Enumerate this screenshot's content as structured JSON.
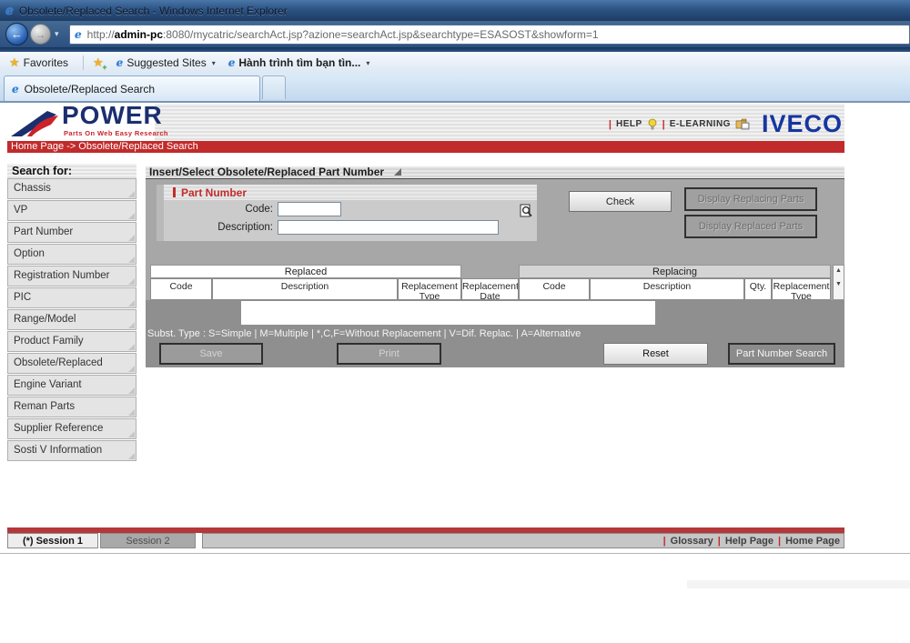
{
  "window": {
    "title": "Obsolete/Replaced Search - Windows Internet Explorer"
  },
  "address_bar": {
    "protocol": "http://",
    "host": "admin-pc",
    "path": ":8080/mycatric/searchAct.jsp?azione=searchAct.jsp&searchtype=ESASOST&showform=1"
  },
  "favorites_bar": {
    "favorites": "Favorites",
    "suggested_sites": "Suggested Sites",
    "pinned_link": "Hành trình tìm bạn tìn..."
  },
  "tabs": {
    "active": "Obsolete/Replaced Search"
  },
  "masthead": {
    "logo": "POWER",
    "tagline": "Parts On Web Easy Research",
    "help": "HELP",
    "elearning": "E-LEARNING",
    "brand": "IVECO"
  },
  "breadcrumb": "Home Page -> Obsolete/Replaced Search",
  "sidebar": {
    "title": "Search for:",
    "items": [
      {
        "label": "Chassis"
      },
      {
        "label": "VP"
      },
      {
        "label": "Part Number"
      },
      {
        "label": "Option"
      },
      {
        "label": "Registration Number"
      },
      {
        "label": "PIC"
      },
      {
        "label": "Range/Model"
      },
      {
        "label": "Product Family"
      },
      {
        "label": "Obsolete/Replaced"
      },
      {
        "label": "Engine Variant"
      },
      {
        "label": "Reman Parts"
      },
      {
        "label": "Supplier Reference"
      },
      {
        "label": "Sosti V Information"
      }
    ]
  },
  "main": {
    "section_title": "Insert/Select Obsolete/Replaced Part Number",
    "part_number": {
      "title": "Part Number",
      "code_label": "Code:",
      "code_value": "",
      "description_label": "Description:",
      "description_value": ""
    },
    "actions": {
      "check": "Check",
      "display_replacing": "Display Replacing Parts",
      "display_replaced": "Display Replaced Parts",
      "save": "Save",
      "print": "Print",
      "reset": "Reset",
      "part_number_search": "Part Number Search"
    },
    "results_table": {
      "replaced_group": "Replaced",
      "replacing_group": "Replacing",
      "replaced_columns": [
        "Code",
        "Description",
        "Replacement Type",
        "Replacement Date"
      ],
      "replacing_columns": [
        "Code",
        "Description",
        "Qty.",
        "Replacement Type"
      ],
      "rows": []
    },
    "legend": "Subst. Type : S=Simple | M=Multiple | *,C,F=Without Replacement | V=Dif. Replac. | A=Alternative"
  },
  "footer": {
    "session1": "(*) Session 1",
    "session2": "Session 2",
    "links": [
      "Glossary",
      "Help Page",
      "Home Page"
    ]
  },
  "icons": {
    "ie_logo": "e",
    "back_arrow": "←",
    "forward_arrow": "→",
    "dropdown": "▾",
    "star": "★",
    "plus": "+",
    "pipe": "|",
    "scroll_up": "▲",
    "scroll_down": "▼"
  },
  "colors": {
    "breadcrumb_red": "#c22b2b",
    "brand_blue": "#1535a0",
    "logo_navy": "#1b2f6e",
    "logo_red": "#cc2229"
  }
}
